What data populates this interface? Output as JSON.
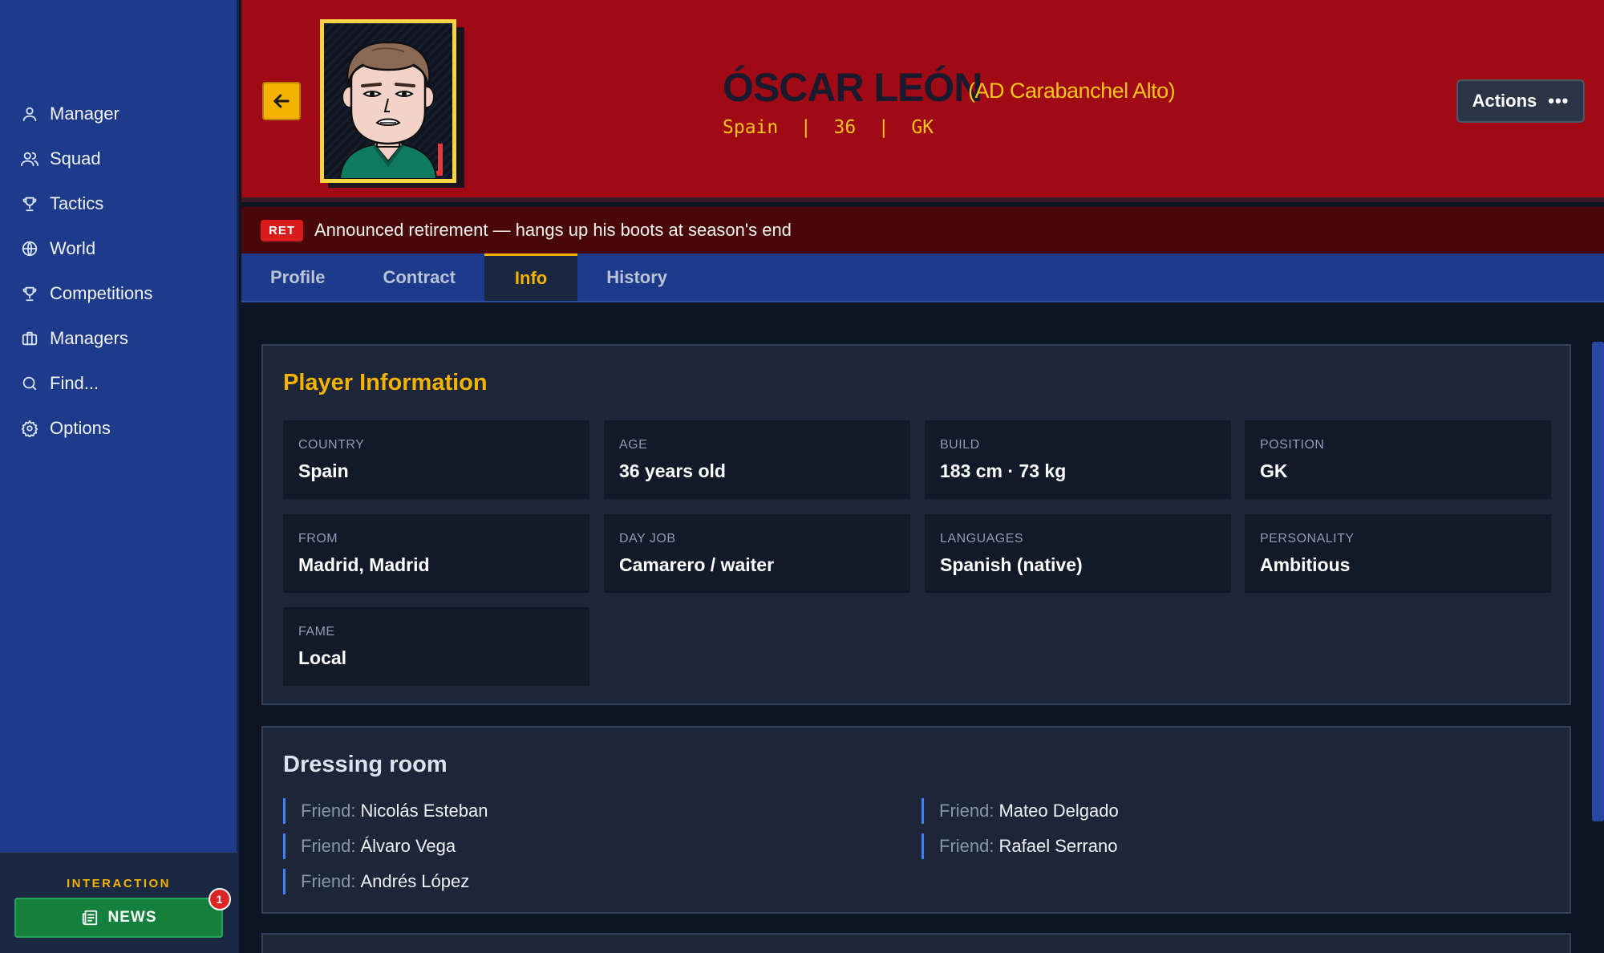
{
  "sidebar": {
    "items": [
      {
        "label": "Manager",
        "icon": "user-icon"
      },
      {
        "label": "Squad",
        "icon": "users-icon"
      },
      {
        "label": "Tactics",
        "icon": "trophy-icon"
      },
      {
        "label": "World",
        "icon": "globe-icon"
      },
      {
        "label": "Competitions",
        "icon": "trophy-icon"
      },
      {
        "label": "Managers",
        "icon": "briefcase-icon"
      },
      {
        "label": "Find...",
        "icon": "search-icon"
      },
      {
        "label": "Options",
        "icon": "gear-icon"
      }
    ],
    "interaction_label": "INTERACTION",
    "news_label": "NEWS",
    "news_badge": "1"
  },
  "header": {
    "name": "ÓSCAR LEÓN",
    "club": "(AD Carabanchel Alto)",
    "meta": "Spain  |  36  |  GK",
    "actions_label": "Actions",
    "actions_icon": "more-horizontal-icon",
    "back_icon": "arrow-left-icon"
  },
  "banner": {
    "badge": "RET",
    "text": "Announced retirement — hangs up his boots at season's end"
  },
  "tabs": [
    {
      "label": "Profile",
      "active": false
    },
    {
      "label": "Contract",
      "active": false
    },
    {
      "label": "Info",
      "active": true
    },
    {
      "label": "History",
      "active": false
    }
  ],
  "player_info": {
    "title": "Player Information",
    "fields": [
      {
        "label": "COUNTRY",
        "value": "Spain"
      },
      {
        "label": "AGE",
        "value": "36 years old"
      },
      {
        "label": "BUILD",
        "value": "183 cm · 73 kg"
      },
      {
        "label": "POSITION",
        "value": "GK"
      },
      {
        "label": "FROM",
        "value": "Madrid, Madrid"
      },
      {
        "label": "DAY JOB",
        "value": "Camarero / waiter"
      },
      {
        "label": "LANGUAGES",
        "value": "Spanish (native)"
      },
      {
        "label": "PERSONALITY",
        "value": "Ambitious"
      },
      {
        "label": "FAME",
        "value": "Local"
      }
    ]
  },
  "dressing_room": {
    "title": "Dressing room",
    "friends": [
      {
        "label": "Friend:",
        "name": "Nicolás Esteban"
      },
      {
        "label": "Friend:",
        "name": "Mateo Delgado"
      },
      {
        "label": "Friend:",
        "name": "Álvaro Vega"
      },
      {
        "label": "Friend:",
        "name": "Rafael Serrano"
      },
      {
        "label": "Friend:",
        "name": "Andrés López"
      }
    ]
  },
  "colors": {
    "sidebar": "#1e3a8a",
    "header": "#a00a15",
    "accent": "#f5b301",
    "news": "#15803d",
    "friend_bar": "#3b82f6"
  }
}
